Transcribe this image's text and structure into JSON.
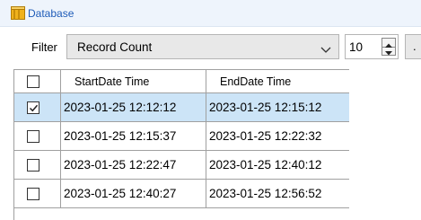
{
  "window": {
    "title": "Database"
  },
  "filter": {
    "label": "Filter",
    "selected": "Record Count",
    "count": "10",
    "more_label": "."
  },
  "grid": {
    "columns": [
      "",
      "StartDate Time",
      "EndDate Time"
    ],
    "rows": [
      {
        "checked": true,
        "start": "2023-01-25 12:12:12",
        "end": "2023-01-25 12:15:12"
      },
      {
        "checked": false,
        "start": "2023-01-25 12:15:37",
        "end": "2023-01-25 12:22:32"
      },
      {
        "checked": false,
        "start": "2023-01-25 12:22:47",
        "end": "2023-01-25 12:40:12"
      },
      {
        "checked": false,
        "start": "2023-01-25 12:40:27",
        "end": "2023-01-25 12:56:52"
      }
    ]
  },
  "colors": {
    "selection": "#cce4f7",
    "title_text": "#1e5bb8",
    "title_bar": "#eef4fc"
  }
}
